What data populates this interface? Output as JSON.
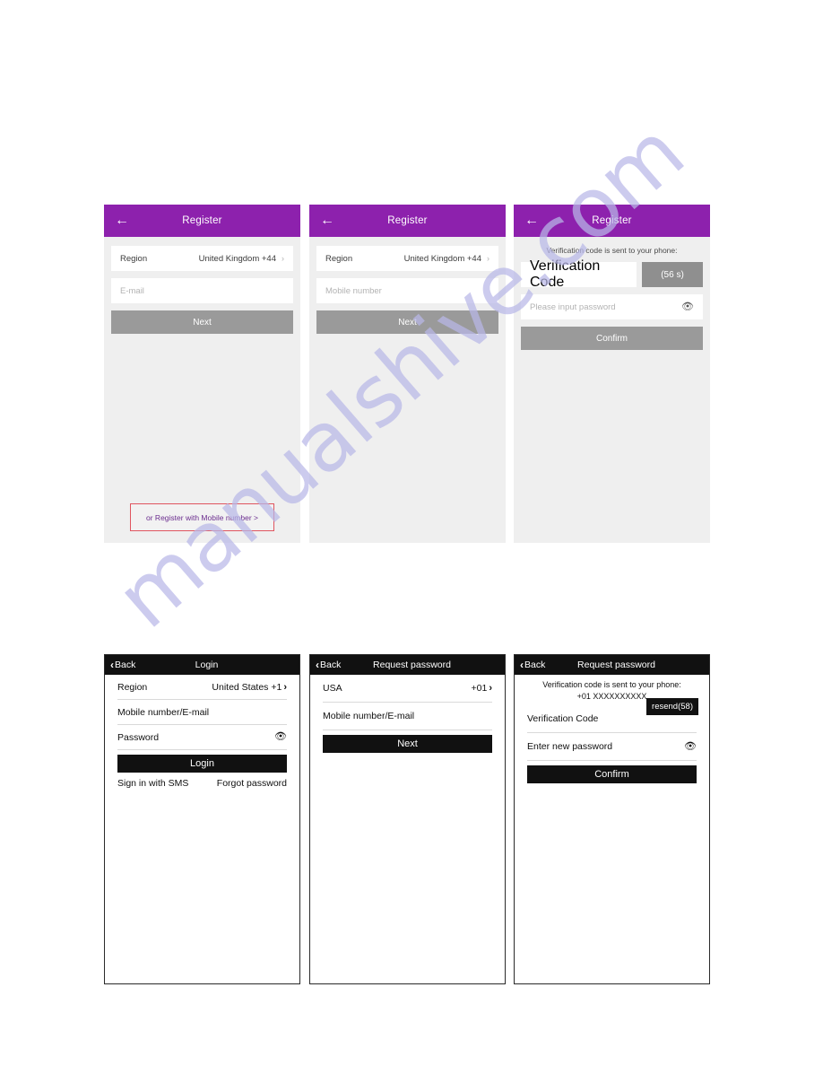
{
  "watermark": {
    "text": "manualshive.com"
  },
  "colors": {
    "purple_header": "#8d21ad",
    "light_bg": "#efefef",
    "grey_button": "#9a9a9a",
    "black_header": "#111111",
    "red_outline": "#e0555f",
    "link_purple": "#6b2d8e"
  },
  "screens": {
    "register_email": {
      "header": {
        "title": "Register",
        "back_icon": "arrow-left-icon"
      },
      "region": {
        "label": "Region",
        "value": "United Kingdom +44",
        "chevron": "chevron-right-icon"
      },
      "email": {
        "placeholder": "E-mail"
      },
      "next_button": "Next",
      "register_mobile_link": "or Register with Mobile number >"
    },
    "register_mobile": {
      "header": {
        "title": "Register",
        "back_icon": "arrow-left-icon"
      },
      "region": {
        "label": "Region",
        "value": "United Kingdom +44",
        "chevron": "chevron-right-icon"
      },
      "mobile": {
        "placeholder": "Mobile number"
      },
      "next_button": "Next"
    },
    "register_verify": {
      "header": {
        "title": "Register",
        "back_icon": "arrow-left-icon"
      },
      "hint": "Verification code is sent to your phone:",
      "code": {
        "placeholder": "Verification Code"
      },
      "timer_button": "(56 s)",
      "password": {
        "placeholder": "Please input password",
        "eye_icon": "eye-icon"
      },
      "confirm_button": "Confirm"
    },
    "login": {
      "header": {
        "title": "Login",
        "back_label": "Back",
        "back_icon": "chevron-left-icon"
      },
      "region": {
        "label": "Region",
        "value": "United States +1",
        "chevron": "chevron-right-icon"
      },
      "account": {
        "label": "Mobile number/E-mail"
      },
      "password": {
        "label": "Password",
        "eye_icon": "eye-icon"
      },
      "login_button": "Login",
      "sms_link": "Sign in with SMS",
      "forgot_link": "Forgot password"
    },
    "request_password": {
      "header": {
        "title": "Request password",
        "back_label": "Back",
        "back_icon": "chevron-left-icon"
      },
      "region": {
        "label": "USA",
        "value": "+01",
        "chevron": "chevron-right-icon"
      },
      "account": {
        "label": "Mobile number/E-mail"
      },
      "next_button": "Next"
    },
    "request_password_verify": {
      "header": {
        "title": "Request password",
        "back_label": "Back",
        "back_icon": "chevron-left-icon"
      },
      "hint_line1": "Verification code is sent to your phone:",
      "hint_line2": "+01 XXXXXXXXXX",
      "code": {
        "label": "Verification Code"
      },
      "resend_button": "resend(58)",
      "password": {
        "label": "Enter new password",
        "eye_icon": "eye-icon"
      },
      "confirm_button": "Confirm"
    }
  }
}
